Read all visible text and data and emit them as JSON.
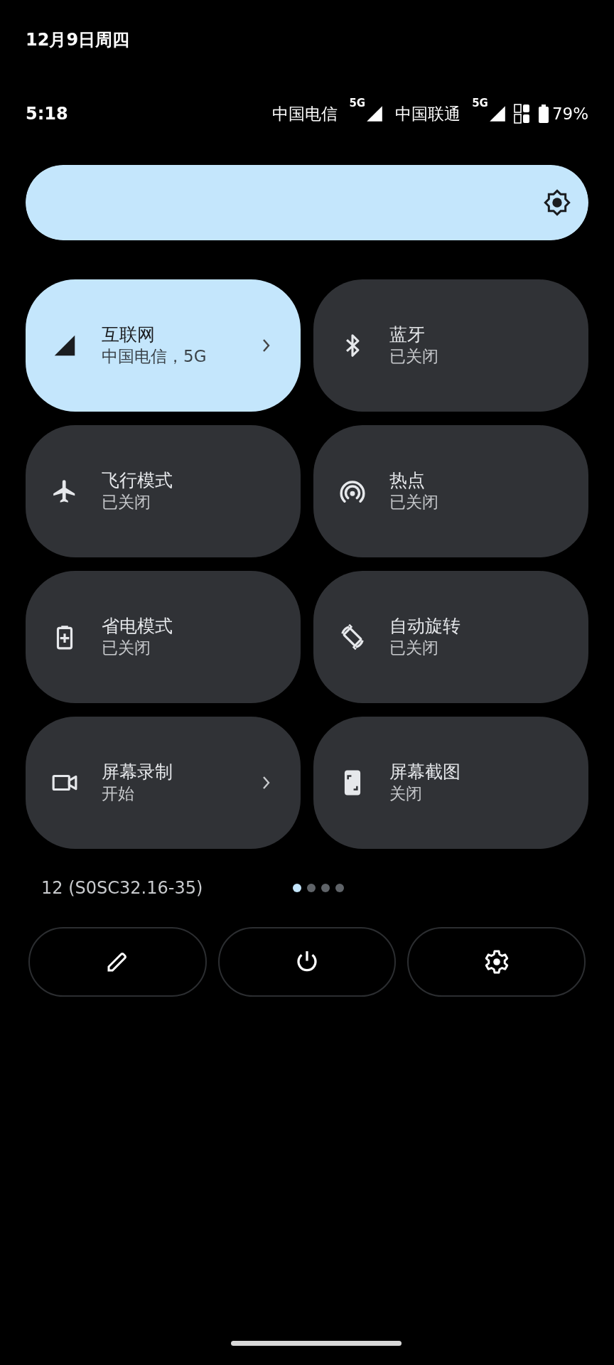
{
  "header": {
    "date": "12月9日周四"
  },
  "status_bar": {
    "time": "5:18",
    "carriers": [
      {
        "name": "中国电信",
        "network": "5G"
      },
      {
        "name": "中国联通",
        "network": "5G"
      }
    ],
    "battery": "79%"
  },
  "brightness": {
    "level": 1.0
  },
  "tiles": [
    {
      "kind": "signal",
      "title": "互联网",
      "subtitle": "中国电信，5G",
      "on": true,
      "chevron": true
    },
    {
      "kind": "bluetooth",
      "title": "蓝牙",
      "subtitle": "已关闭",
      "on": false,
      "chevron": false
    },
    {
      "kind": "airplane",
      "title": "飞行模式",
      "subtitle": "已关闭",
      "on": false,
      "chevron": false
    },
    {
      "kind": "hotspot",
      "title": "热点",
      "subtitle": "已关闭",
      "on": false,
      "chevron": false
    },
    {
      "kind": "battery",
      "title": "省电模式",
      "subtitle": "已关闭",
      "on": false,
      "chevron": false
    },
    {
      "kind": "rotate",
      "title": "自动旋转",
      "subtitle": "已关闭",
      "on": false,
      "chevron": false
    },
    {
      "kind": "camera",
      "title": "屏幕录制",
      "subtitle": "开始",
      "on": false,
      "chevron": true
    },
    {
      "kind": "screenshot",
      "title": "屏幕截图",
      "subtitle": "关闭",
      "on": false,
      "chevron": false
    }
  ],
  "build": "12 (S0SC32.16-35)",
  "pages": [
    {
      "selected": true
    },
    {
      "selected": false
    },
    {
      "selected": false
    },
    {
      "selected": false
    }
  ],
  "actions": [
    {
      "kind": "edit"
    },
    {
      "kind": "power"
    },
    {
      "kind": "settings"
    }
  ]
}
